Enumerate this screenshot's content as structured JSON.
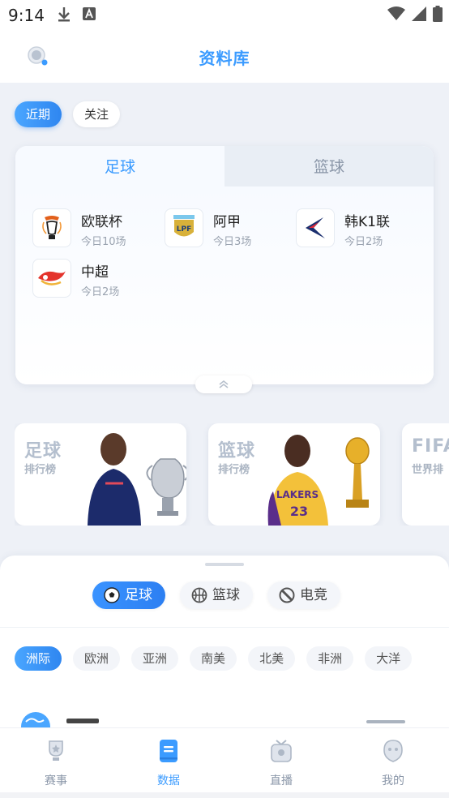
{
  "status_bar": {
    "time": "9:14",
    "icons": [
      "download-icon",
      "font-a-icon",
      "wifi-icon",
      "signal-icon",
      "battery-icon"
    ]
  },
  "header": {
    "title": "资料库"
  },
  "filters": [
    {
      "label": "近期",
      "active": true
    },
    {
      "label": "关注",
      "active": false
    }
  ],
  "league_card": {
    "tabs": [
      {
        "label": "足球",
        "active": true
      },
      {
        "label": "篮球",
        "active": false
      }
    ],
    "items": [
      {
        "name": "欧联杯",
        "count": "今日10场",
        "logo": "europa-league-logo"
      },
      {
        "name": "阿甲",
        "count": "今日3场",
        "logo": "argentina-lpf-logo"
      },
      {
        "name": "韩K1联",
        "count": "今日2场",
        "logo": "k-league-logo"
      },
      {
        "name": "中超",
        "count": "今日2场",
        "logo": "csl-logo"
      }
    ]
  },
  "rankings": [
    {
      "title": "足球",
      "subtitle": "排行榜"
    },
    {
      "title": "篮球",
      "subtitle": "排行榜"
    },
    {
      "title": "FIFA",
      "subtitle": "世界排"
    }
  ],
  "sheet": {
    "sport_tabs": [
      {
        "label": "足球",
        "icon": "soccer-ball-icon",
        "active": true
      },
      {
        "label": "篮球",
        "icon": "basketball-icon",
        "active": false
      },
      {
        "label": "电竞",
        "icon": "esports-icon",
        "active": false
      }
    ],
    "regions": [
      {
        "label": "洲际",
        "active": true
      },
      {
        "label": "欧洲",
        "active": false
      },
      {
        "label": "亚洲",
        "active": false
      },
      {
        "label": "南美",
        "active": false
      },
      {
        "label": "北美",
        "active": false
      },
      {
        "label": "非洲",
        "active": false
      },
      {
        "label": "大洋",
        "active": false
      }
    ]
  },
  "bottom_nav": [
    {
      "label": "赛事",
      "icon": "trophy-icon",
      "active": false
    },
    {
      "label": "数据",
      "icon": "data-book-icon",
      "active": true
    },
    {
      "label": "直播",
      "icon": "tv-icon",
      "active": false
    },
    {
      "label": "我的",
      "icon": "profile-icon",
      "active": false
    }
  ],
  "colors": {
    "accent": "#3b9bff",
    "background": "#eef1f7",
    "muted": "#9aa3b0"
  }
}
